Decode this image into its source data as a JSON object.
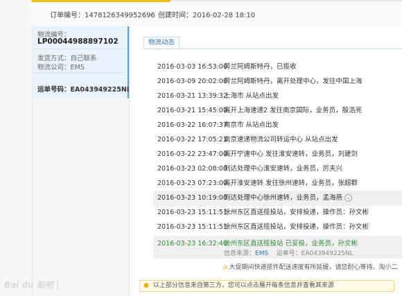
{
  "order": {
    "number_label": "订单编号：",
    "number": "1478126349952696",
    "created_label": "创建时间：",
    "created": "2016-02-28 18:10"
  },
  "logistics": {
    "id_label": "物流编号：",
    "id": "LP00044988897102",
    "ship_method": "发货方式：自己联系",
    "company": "物流公司：EMS",
    "waybill_label": "运单号码：",
    "waybill": "EA043949225NL"
  },
  "tab": {
    "label": "物流动态"
  },
  "events": [
    {
      "time": "2016-03-03 16:53:00",
      "desc": "荷兰阿姆斯特丹，已揽收"
    },
    {
      "time": "2016-03-09 20:02:00",
      "desc": "荷兰阿姆斯特丹，离开处理中心，发往中国上海"
    },
    {
      "time": "2016-03-21 13:39:32",
      "desc": "上海市 从站点出发"
    },
    {
      "time": "2016-03-21 15:45:00",
      "desc": "离开上海速递2 发往南京国际，业务员，殷浩亮"
    },
    {
      "time": "2016-03-22 16:07:37",
      "desc": "南京市 从站点出发"
    },
    {
      "time": "2016-03-22 17:05:21",
      "desc": "南京速递物流公司转运中心 从站点出发"
    },
    {
      "time": "2016-03-22 23:47:00",
      "desc": "离开宁速中心 发往淮安速转，业务员，刘建剑"
    },
    {
      "time": "2016-03-23 02:08:00",
      "desc": "到达处理中心淮安速转，业务员，厉夫兴"
    },
    {
      "time": "2016-03-23 07:23:00",
      "desc": "离开淮安速转 发往徐州速转，业务员，张超群"
    },
    {
      "time": "2016-03-23 10:19:00",
      "desc": "到达处理中心徐州速转，业务员，孟海燕"
    },
    {
      "time": "2016-03-23 15:11:51",
      "desc": "徐州东区直送揽投站，安排投递，操作员：孙文彬"
    },
    {
      "time": "2016-03-23 15:11:51",
      "desc": "徐州东区直送揽投站，安排投递，操作员：孙文彬"
    }
  ],
  "final_event": {
    "time": "2016-03-23 16:32:40",
    "desc": "徐州东区直送揽投站 已妥投，业务员，孙文彬",
    "source_label": "信息来源：",
    "source": "EMS",
    "waybill_label": "运单号：",
    "waybill": "EA043949225NL"
  },
  "promo": "大促期间快递揽件配送速度有所延缓，请您耐心等待。淘小二",
  "tip": "以上部分信息来自第三方，您可以点击展开每条信息并查看其来源",
  "watermark": "Bai du 贴吧 |",
  "colors": {
    "accent": "#4aa0e8",
    "link": "#2a73b8",
    "success": "#2e8b3a",
    "tip_bg": "#fffbe6"
  }
}
